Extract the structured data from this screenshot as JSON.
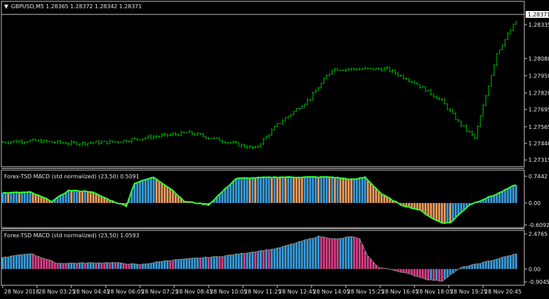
{
  "colors": {
    "background": "#000000",
    "frame": "#c8c8c8",
    "bar": "#00c800",
    "up_blue": "#3aa0e0",
    "down_orange": "#f0a060",
    "macd_line": "#33ff33",
    "pink": "#e0408a",
    "gray_line": "#888888",
    "label_bg": "#ffffff",
    "label_fg": "#000000"
  },
  "main": {
    "symbol_arrow": "▼",
    "header": "GBPUSD,M5  1.28365 1.28372 1.28342 1.28371",
    "price_ticks": [
      "1.28335",
      "1.28080",
      "1.27950",
      "1.27820",
      "1.27695",
      "1.27565",
      "1.27440",
      "1.27315"
    ],
    "current_price": "1.28371",
    "ylim": [
      1.2728,
      1.2849
    ]
  },
  "indicator1": {
    "title": "Forex-TSD MACD (std normalized) (23,50) 0.5091",
    "ticks": [
      "0.7442",
      "0.00",
      "-0.6092"
    ],
    "ylim": [
      -0.6092,
      0.7442
    ]
  },
  "indicator2": {
    "title": "Forex-TSD MACD (std normalized) (23,50) 1.0593",
    "ticks": [
      "2.4765",
      "0.00",
      "-0.9045"
    ],
    "ylim": [
      -0.9045,
      2.4765
    ]
  },
  "time_axis": [
    "28 Nov 2018",
    "28 Nov 03:25",
    "28 Nov 04:45",
    "28 Nov 06:05",
    "28 Nov 07:25",
    "28 Nov 08:45",
    "28 Nov 10:05",
    "28 Nov 11:25",
    "28 Nov 12:45",
    "28 Nov 14:05",
    "28 Nov 15:25",
    "28 Nov 16:45",
    "28 Nov 18:05",
    "28 Nov 19:25",
    "28 Nov 20:45"
  ],
  "chart_data": [
    {
      "type": "ohlc",
      "title": "GBPUSD,M5",
      "anchors_x": [
        0,
        10,
        25,
        40,
        55,
        68,
        80,
        92,
        100,
        112,
        120,
        140,
        150,
        160,
        166,
        172,
        180,
        187
      ],
      "anchors_close": [
        1.2745,
        1.2746,
        1.2744,
        1.2745,
        1.2749,
        1.2752,
        1.2746,
        1.274,
        1.2758,
        1.2778,
        1.28,
        1.28,
        1.279,
        1.2776,
        1.276,
        1.2748,
        1.2812,
        1.2836
      ],
      "last_close": 1.28371
    },
    {
      "type": "histogram",
      "title": "Forex-TSD MACD (std normalized) (23,50) 0.5091",
      "anchors_x": [
        0,
        10,
        18,
        24,
        32,
        40,
        45,
        48,
        55,
        62,
        66,
        75,
        85,
        100,
        120,
        128,
        132,
        138,
        145,
        152,
        157,
        160,
        163,
        170,
        180,
        187
      ],
      "anchors_v": [
        0.28,
        0.3,
        0.05,
        0.35,
        0.32,
        0.05,
        -0.08,
        0.55,
        0.72,
        0.35,
        0.05,
        -0.05,
        0.68,
        0.72,
        0.72,
        0.65,
        0.72,
        0.25,
        -0.05,
        -0.2,
        -0.45,
        -0.55,
        -0.55,
        -0.05,
        0.25,
        0.51
      ],
      "colors": [
        "up_blue",
        "down_orange"
      ]
    },
    {
      "type": "histogram",
      "title": "Forex-TSD MACD (std normalized) (23,50) 1.0593",
      "anchors_x": [
        0,
        10,
        20,
        40,
        50,
        60,
        80,
        100,
        115,
        122,
        127,
        130,
        133,
        137,
        142,
        148,
        155,
        160,
        163,
        167,
        175,
        187
      ],
      "anchors_v": [
        0.8,
        1.1,
        0.4,
        0.45,
        0.3,
        0.6,
        0.9,
        1.45,
        2.3,
        2.1,
        2.3,
        2.1,
        0.9,
        0.1,
        -0.05,
        -0.35,
        -0.75,
        -0.85,
        -0.4,
        0.1,
        0.45,
        1.06
      ],
      "colors": [
        "up_blue",
        "pink"
      ]
    }
  ]
}
